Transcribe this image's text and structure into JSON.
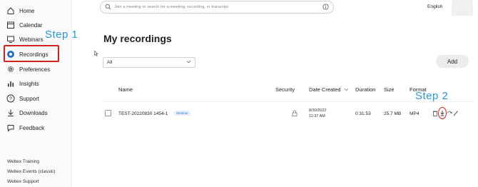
{
  "sidebar": {
    "items": [
      {
        "label": "Home",
        "icon": "home-icon"
      },
      {
        "label": "Calendar",
        "icon": "calendar-icon"
      },
      {
        "label": "Webinars",
        "icon": "webinars-icon"
      },
      {
        "label": "Recordings",
        "icon": "recordings-icon",
        "active": true
      },
      {
        "label": "Preferences",
        "icon": "gear-icon"
      },
      {
        "label": "Insights",
        "icon": "insights-icon"
      },
      {
        "label": "Support",
        "icon": "help-icon"
      },
      {
        "label": "Downloads",
        "icon": "download-icon"
      },
      {
        "label": "Feedback",
        "icon": "feedback-icon"
      }
    ],
    "footer_links": [
      "Webex Training",
      "Webex Events (classic)",
      "Webex Support"
    ]
  },
  "annotations": {
    "step1": "Step 1",
    "step2": "Step 2",
    "highlight_color": "#d32020",
    "step_color": "#2a98d6"
  },
  "header": {
    "search_placeholder": "Join a meeting or search for a meeting, recording, or transcript",
    "language": "English"
  },
  "main": {
    "title": "My recordings",
    "filter_value": "All",
    "add_label": "Add",
    "columns": {
      "name": "Name",
      "security": "Security",
      "date_created": "Date Created",
      "duration": "Duration",
      "size": "Size",
      "format": "Format"
    },
    "rows": [
      {
        "name": "TEST-20220830 1454-1",
        "badge": "Webinar",
        "date": "8/30/2022",
        "time": "11:37 AM",
        "duration": "0:31:53",
        "size": "25.7 MB",
        "format": "MP4",
        "actions": [
          "trash-icon",
          "download-icon",
          "share-icon",
          "edit-icon"
        ]
      }
    ]
  }
}
